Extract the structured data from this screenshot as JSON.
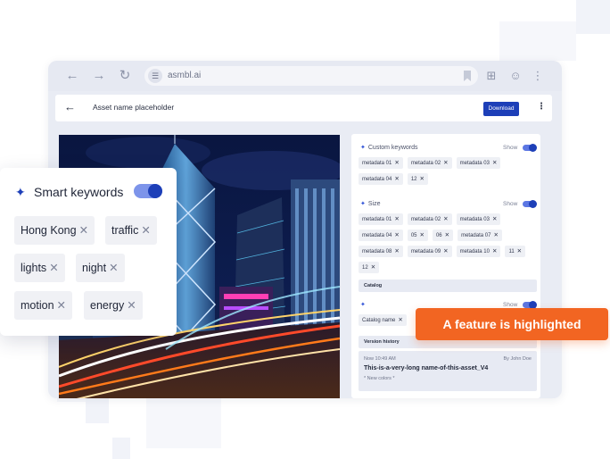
{
  "browser": {
    "url": "asmbl.ai",
    "nav_icons": [
      "back-arrow-icon",
      "forward-arrow-icon",
      "reload-icon"
    ],
    "toolbar_icons": [
      "bookmark-icon",
      "apps-grid-icon",
      "account-icon",
      "more-vert-icon"
    ]
  },
  "header": {
    "back_icon": "←",
    "asset_name": "Asset name placeholder",
    "download_label": "Download",
    "menu_icon": "⋮"
  },
  "panel": {
    "custom_keywords": {
      "title": "Custom keywords",
      "show_label": "Show",
      "tags": [
        "metadata 01",
        "metadata 02",
        "metadata 03",
        "metadata 04",
        "12"
      ]
    },
    "size": {
      "title": "Size",
      "show_label": "Show",
      "tags": [
        "metadata 01",
        "metadata 02",
        "metadata 03",
        "metadata 04",
        "05",
        "06",
        "metadata 07",
        "metadata 08",
        "metadata 09",
        "metadata 10",
        "11",
        "12"
      ]
    },
    "catalog": {
      "bar_label": "Catalog",
      "show_label": "Show",
      "tags": [
        "Catalog name"
      ]
    },
    "version_history": {
      "bar_label": "Version history",
      "time": "Now  10:49 AM",
      "user": "By John Doe",
      "name": "This-is-a-very-long name-of-this-asset_V4",
      "note": "* New colors *"
    }
  },
  "smart_keywords": {
    "title": "Smart keywords",
    "enabled": true,
    "tags": [
      "Hong Kong",
      "traffic",
      "lights",
      "night",
      "motion",
      "energy"
    ]
  },
  "callout": {
    "text": "A feature is highlighted",
    "color": "#f26522"
  },
  "colors": {
    "accent": "#1d3fb8",
    "highlight": "#f26522"
  }
}
